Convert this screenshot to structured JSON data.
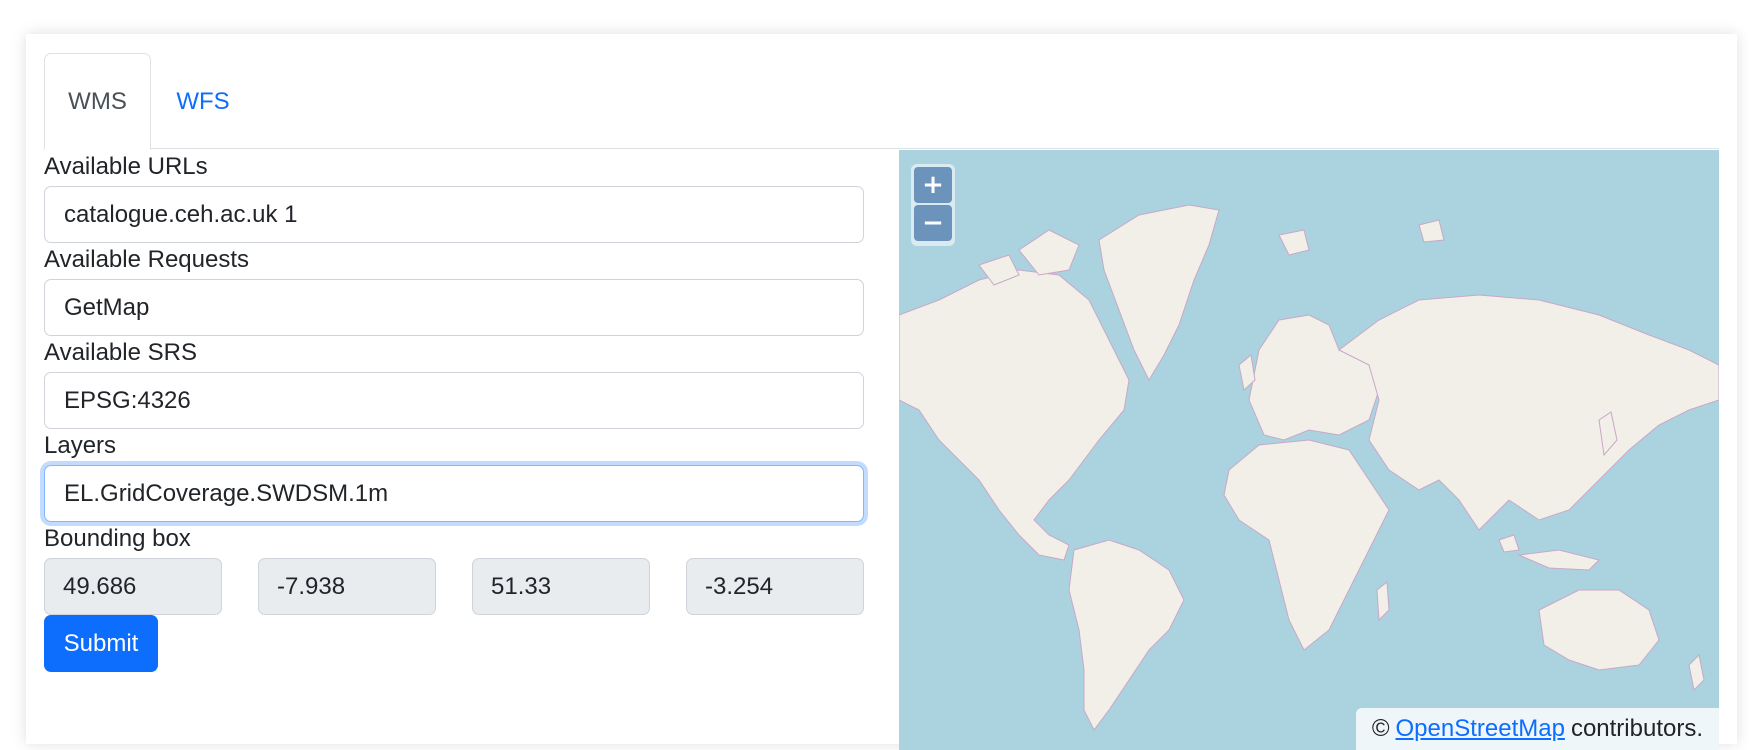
{
  "tabs": [
    {
      "label": "WMS",
      "active": true
    },
    {
      "label": "WFS",
      "active": false
    }
  ],
  "form": {
    "urls": {
      "label": "Available URLs",
      "value": "catalogue.ceh.ac.uk 1"
    },
    "requests": {
      "label": "Available Requests",
      "value": "GetMap"
    },
    "srs": {
      "label": "Available SRS",
      "value": "EPSG:4326"
    },
    "layers": {
      "label": "Layers",
      "value": "EL.GridCoverage.SWDSM.1m"
    },
    "bbox": {
      "label": "Bounding box",
      "values": [
        "49.686",
        "-7.938",
        "51.33",
        "-3.254"
      ]
    },
    "submit_label": "Submit"
  },
  "map": {
    "zoom_in": "+",
    "zoom_out": "−",
    "attribution": {
      "prefix": "©",
      "link": "OpenStreetMap",
      "suffix": "contributors."
    },
    "colors": {
      "water": "#aad3df",
      "land": "#f2efe9",
      "border": "#c8a8c8",
      "accent": "#0d6efd"
    }
  }
}
